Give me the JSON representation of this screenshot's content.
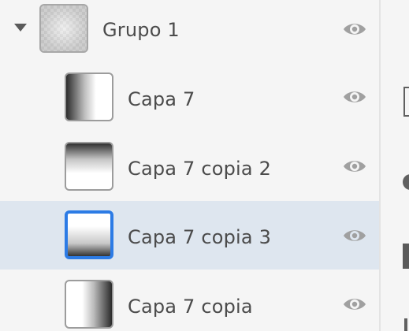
{
  "layers": {
    "group": {
      "name": "Grupo 1",
      "expanded": true,
      "visible": true
    },
    "items": [
      {
        "name": "Capa 7",
        "visible": true,
        "selected": false,
        "thumbnail": "gradient-dark-left"
      },
      {
        "name": "Capa 7 copia 2",
        "visible": true,
        "selected": false,
        "thumbnail": "gradient-dark-top"
      },
      {
        "name": "Capa 7 copia 3",
        "visible": true,
        "selected": true,
        "thumbnail": "gradient-dark-bottom"
      },
      {
        "name": "Capa 7 copia",
        "visible": true,
        "selected": false,
        "thumbnail": "gradient-dark-right"
      }
    ]
  },
  "icons": {
    "expand": "triangle-down-icon",
    "visibility": "eye-icon"
  },
  "colors": {
    "panel_background": "#f5f5f5",
    "selected_row": "#dee6ef",
    "selection_border": "#2c7be5",
    "text": "#4b4b4b",
    "icon": "#a0a0a0"
  }
}
